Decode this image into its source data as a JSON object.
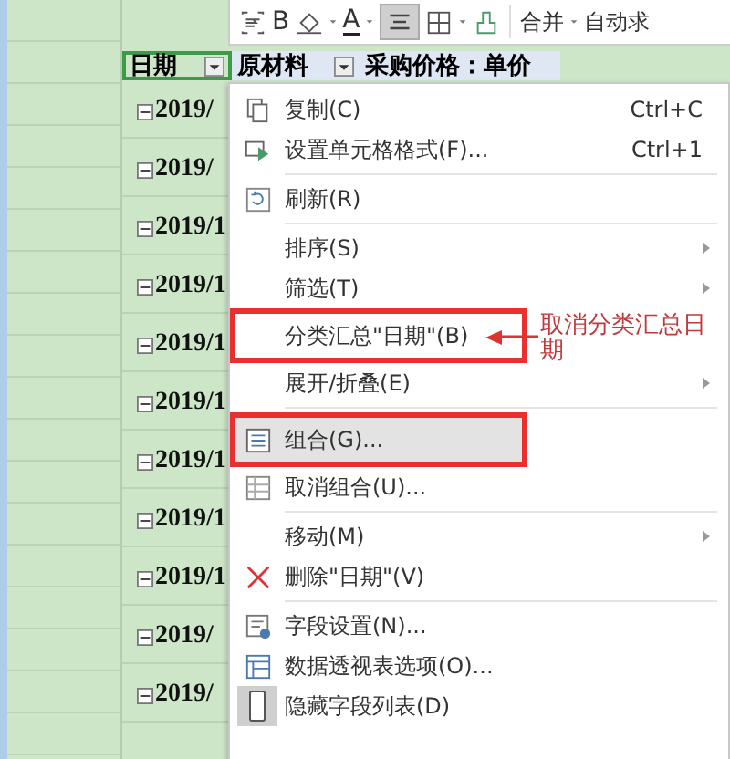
{
  "toolbar": {
    "bold_label": "B",
    "font_color_label": "A",
    "align_selected": true,
    "merge_label": "合并",
    "autosum_label": "自动求"
  },
  "header_cells": [
    {
      "label": "日期",
      "selected": true
    },
    {
      "label": "原材料",
      "selected": false
    },
    {
      "label": "采购价格：单价",
      "selected": false
    }
  ],
  "rows": [
    {
      "label": "2019/"
    },
    {
      "label": "2019/"
    },
    {
      "label": "2019/1"
    },
    {
      "label": "2019/1"
    },
    {
      "label": "2019/1"
    },
    {
      "label": "2019/1"
    },
    {
      "label": "2019/1"
    },
    {
      "label": "2019/1"
    },
    {
      "label": "2019/1"
    },
    {
      "label": "2019/"
    },
    {
      "label": "2019/"
    }
  ],
  "context_menu": {
    "items": [
      {
        "kind": "copy",
        "label": "复制(C)",
        "shortcut": "Ctrl+C",
        "selected": false,
        "boxed": false,
        "separator_after": false
      },
      {
        "kind": "format",
        "label": "设置单元格格式(F)...",
        "shortcut": "Ctrl+1",
        "selected": false,
        "boxed": false,
        "separator_after": true
      },
      {
        "kind": "refresh",
        "label": "刷新(R)",
        "selected": false,
        "boxed": false,
        "separator_after": true
      },
      {
        "kind": "submenu",
        "label": "排序(S)",
        "selected": false,
        "boxed": false,
        "separator_after": false
      },
      {
        "kind": "submenu",
        "label": "筛选(T)",
        "selected": false,
        "boxed": false,
        "separator_after": false
      },
      {
        "kind": "plain",
        "label": "分类汇总\"日期\"(B)",
        "selected": false,
        "boxed": true,
        "separator_after": false
      },
      {
        "kind": "submenu",
        "label": "展开/折叠(E)",
        "selected": false,
        "boxed": false,
        "separator_after": true
      },
      {
        "kind": "group",
        "label": "组合(G)...",
        "selected": true,
        "boxed": true,
        "separator_after": false
      },
      {
        "kind": "ungroup",
        "label": "取消组合(U)...",
        "selected": false,
        "boxed": false,
        "separator_after": true
      },
      {
        "kind": "submenu",
        "label": "移动(M)",
        "selected": false,
        "boxed": false,
        "separator_after": false
      },
      {
        "kind": "delete",
        "label": "删除\"日期\"(V)",
        "selected": false,
        "boxed": false,
        "separator_after": true
      },
      {
        "kind": "fieldsettings",
        "label": "字段设置(N)...",
        "selected": false,
        "boxed": false,
        "separator_after": false
      },
      {
        "kind": "options",
        "label": "数据透视表选项(O)...",
        "selected": false,
        "boxed": false,
        "separator_after": false
      },
      {
        "kind": "hidelist",
        "label": "隐藏字段列表(D)",
        "selected": false,
        "boxed": false,
        "separator_after": false
      }
    ]
  },
  "callout": {
    "text": "取消分类汇总日期"
  }
}
